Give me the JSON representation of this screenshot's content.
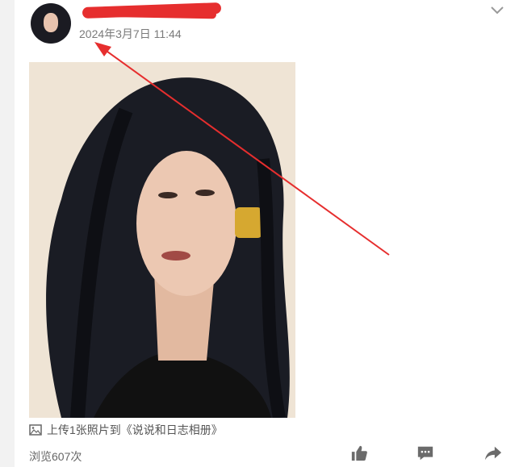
{
  "post": {
    "username": "",
    "timestamp": "2024年3月7日 11:44",
    "caption": "上传1张照片到《说说和日志相册》",
    "views": "浏览607次"
  },
  "icons": {
    "more": "chevron-down-icon",
    "image": "image-icon",
    "like": "thumbs-up-icon",
    "comment": "comment-icon",
    "share": "share-icon"
  },
  "colors": {
    "background": "#f2f2f2",
    "card": "#ffffff",
    "annotation": "#e62e2e",
    "action_icon": "#6b6b6b"
  }
}
